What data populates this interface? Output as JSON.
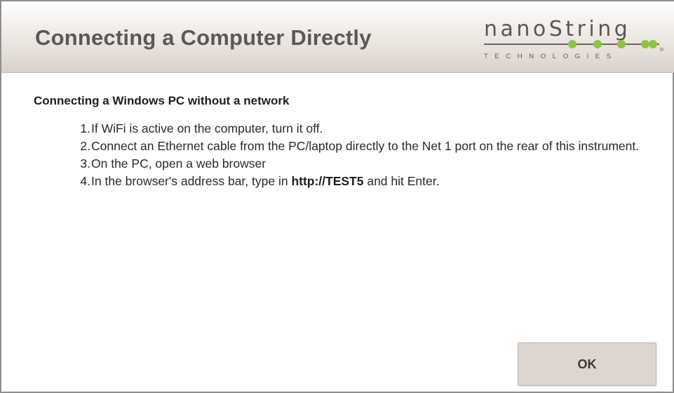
{
  "dialog": {
    "title": "Connecting a Computer Directly",
    "logo": {
      "word": "nanoString",
      "subtitle": "TECHNOLOGIES",
      "registered_mark": "®",
      "dot_color": "#8cc63f"
    },
    "section_heading": "Connecting a Windows PC without a network",
    "steps": [
      {
        "number": "1.",
        "text": "If WiFi is active on the computer, turn it off."
      },
      {
        "number": "2.",
        "text": "Connect an Ethernet cable from the PC/laptop directly to the Net 1 port on the rear of this instrument."
      },
      {
        "number": "3.",
        "text": "On the PC, open a web browser"
      },
      {
        "number": "4.",
        "text_before": "In the browser's address bar, type in ",
        "text_bold": "http://TEST5",
        "text_after": " and hit Enter."
      }
    ],
    "ok_label": "OK"
  },
  "colors": {
    "title_text": "#5d5856",
    "button_bg": "#ddd6d0",
    "accent_green": "#8cc63f"
  }
}
